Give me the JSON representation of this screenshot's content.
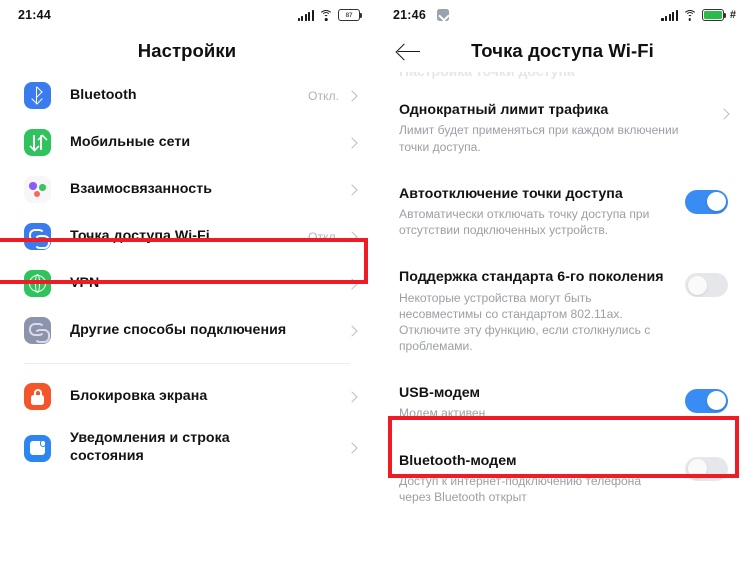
{
  "left_screen": {
    "status_bar": {
      "time": "21:44",
      "signal_icon": "cellular-signal-icon",
      "wifi_icon": "wifi-icon",
      "battery_icon": "battery-icon",
      "battery_level": "87"
    },
    "header": {
      "title": "Настройки"
    },
    "items": [
      {
        "label": "Bluetooth",
        "value": "Откл.",
        "icon": "bluetooth-icon",
        "chevron": true
      },
      {
        "label": "Мобильные сети",
        "value": "",
        "icon": "mobile-networks-icon",
        "chevron": true
      },
      {
        "label": "Взаимосвязанность",
        "value": "",
        "icon": "interconnectivity-icon",
        "chevron": true
      },
      {
        "label": "Точка доступа Wi-Fi",
        "value": "Откл.",
        "icon": "wifi-hotspot-icon",
        "chevron": true
      },
      {
        "label": "VPN",
        "value": "",
        "icon": "vpn-globe-icon",
        "chevron": true
      },
      {
        "label": "Другие способы подключения",
        "value": "",
        "icon": "other-connections-icon",
        "chevron": true
      }
    ],
    "items_group2": [
      {
        "label": "Блокировка экрана",
        "value": "",
        "icon": "screen-lock-icon",
        "chevron": true
      },
      {
        "label": "Уведомления и строка состояния",
        "value": "",
        "icon": "notifications-icon",
        "chevron": true
      }
    ],
    "highlight_color": "#ee1c25"
  },
  "right_screen": {
    "status_bar": {
      "time": "21:46",
      "notification_icon": "screenshot-icon",
      "signal_icon": "cellular-signal-icon",
      "wifi_icon": "wifi-icon",
      "battery_icon": "battery-icon",
      "battery_level": "",
      "trailing_glyph": "#"
    },
    "header": {
      "title": "Точка доступа Wi-Fi",
      "back_icon": "back-arrow-icon"
    },
    "partial_top_row": "Настройка точки доступа",
    "items": [
      {
        "title": "Однократный лимит трафика",
        "subtitle": "Лимит будет применяться при каждом включении точки доступа.",
        "control": "chevron"
      },
      {
        "title": "Автоотключение точки доступа",
        "subtitle": "Автоматически отключать точку доступа при отсутствии подключенных устройств.",
        "control": "toggle",
        "toggle_state": "on"
      },
      {
        "title": "Поддержка стандарта 6-го поколения",
        "subtitle": "Некоторые устройства могут быть несовместимы со стандартом 802.11ax. Отключите эту функцию, если столкнулись с проблемами.",
        "control": "toggle",
        "toggle_state": "off"
      },
      {
        "title": "USB-модем",
        "subtitle": "Модем активен",
        "control": "toggle",
        "toggle_state": "on"
      },
      {
        "title": "Bluetooth-модем",
        "subtitle": "Доступ к интернет-подключению телефона через Bluetooth открыт",
        "control": "toggle",
        "toggle_state": "off"
      }
    ],
    "highlight_color": "#ee1c25"
  }
}
